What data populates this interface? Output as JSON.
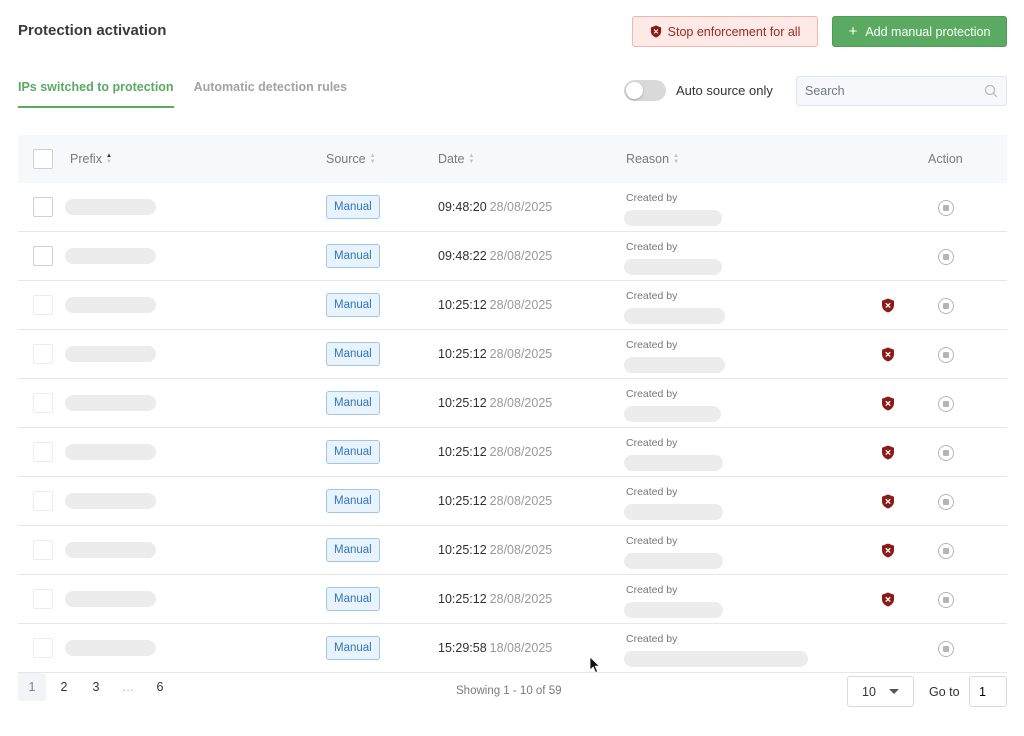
{
  "header": {
    "title": "Protection activation",
    "stop_label": "Stop enforcement for all",
    "add_label": "Add manual protection"
  },
  "tabs": [
    {
      "label": "IPs switched to protection",
      "active": true
    },
    {
      "label": "Automatic detection rules",
      "active": false
    }
  ],
  "filters": {
    "auto_source_label": "Auto source only",
    "auto_source_on": false,
    "search_placeholder": "Search"
  },
  "table": {
    "columns": {
      "prefix": "Prefix",
      "source": "Source",
      "date": "Date",
      "reason": "Reason",
      "action": "Action"
    },
    "rows": [
      {
        "source": "Manual",
        "time": "09:48:20",
        "day": "28/08/2025",
        "reason": "Created by",
        "shield": false
      },
      {
        "source": "Manual",
        "time": "09:48:22",
        "day": "28/08/2025",
        "reason": "Created by",
        "shield": false
      },
      {
        "source": "Manual",
        "time": "10:25:12",
        "day": "28/08/2025",
        "reason": "Created by",
        "shield": true
      },
      {
        "source": "Manual",
        "time": "10:25:12",
        "day": "28/08/2025",
        "reason": "Created by",
        "shield": true
      },
      {
        "source": "Manual",
        "time": "10:25:12",
        "day": "28/08/2025",
        "reason": "Created by",
        "shield": true
      },
      {
        "source": "Manual",
        "time": "10:25:12",
        "day": "28/08/2025",
        "reason": "Created by",
        "shield": true
      },
      {
        "source": "Manual",
        "time": "10:25:12",
        "day": "28/08/2025",
        "reason": "Created by",
        "shield": true
      },
      {
        "source": "Manual",
        "time": "10:25:12",
        "day": "28/08/2025",
        "reason": "Created by",
        "shield": true
      },
      {
        "source": "Manual",
        "time": "10:25:12",
        "day": "28/08/2025",
        "reason": "Created by",
        "shield": true
      },
      {
        "source": "Manual",
        "time": "15:29:58",
        "day": "18/08/2025",
        "reason": "Created by",
        "shield": false
      }
    ]
  },
  "pagination": {
    "pages": [
      "1",
      "2",
      "3",
      "…",
      "6"
    ],
    "current": "1",
    "showing": "Showing 1 - 10 of 59",
    "page_size": "10",
    "goto_label": "Go to",
    "goto_value": "1"
  },
  "colors": {
    "accent": "#5aaa62",
    "danger": "#8b1a1a",
    "badge": "#3176b6"
  },
  "icons": [
    "shield-icon",
    "plus-icon",
    "search-icon",
    "sort-icon",
    "stop-icon",
    "chevron-down-icon",
    "cursor-icon"
  ]
}
